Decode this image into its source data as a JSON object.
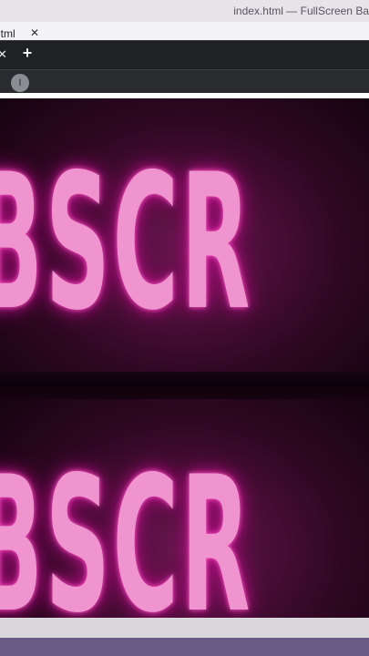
{
  "window": {
    "title": "index.html — FullScreen Ba"
  },
  "tabs": [
    {
      "label": "html",
      "close": "✕"
    }
  ],
  "toolbar": {
    "close_glyph": "✕",
    "new_tab_glyph": "+"
  },
  "extension": {
    "icon": "cursor-icon",
    "glyph": "I"
  },
  "page": {
    "headline_top": "BSCR",
    "headline_bottom": "BSCR",
    "colors": {
      "neon": "#ef94cf",
      "glow": "#c3158f",
      "background": "#2b0720"
    }
  }
}
